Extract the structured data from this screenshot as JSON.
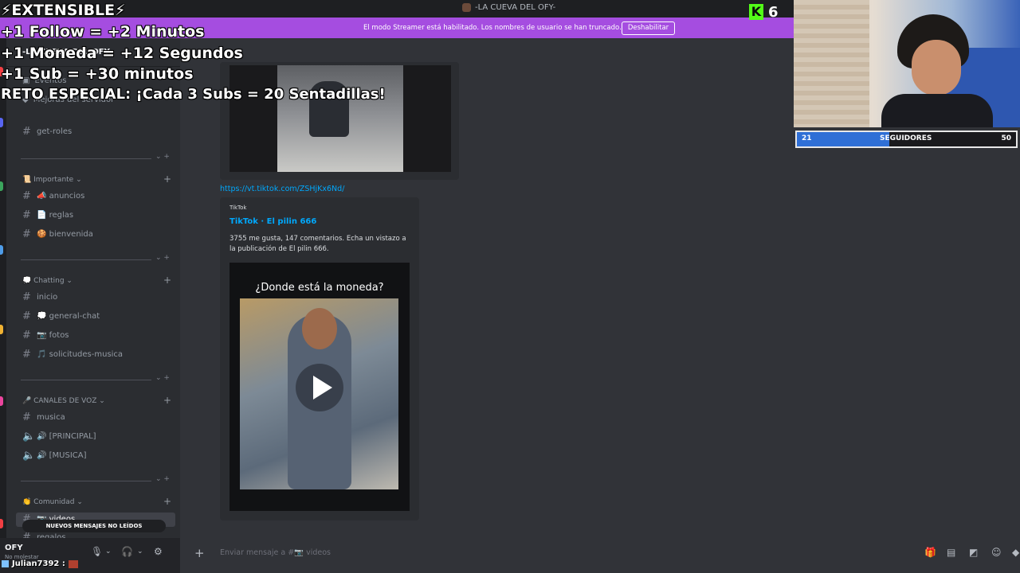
{
  "window": {
    "title": "-LA CUEVA DEL OFY-"
  },
  "banner": {
    "message": "El modo Streamer está habilitado. Los nombres de usuario se han truncado.",
    "button": "Deshabilitar"
  },
  "server": {
    "name": "-LA CUEVA DEL OFY-",
    "header_extra": "os"
  },
  "sidebar": {
    "top_items": [
      {
        "label": "Eventos"
      },
      {
        "label": "Mejoras del servidor"
      }
    ],
    "get_roles": "get-roles",
    "categories": [
      {
        "label": "📜 Importante",
        "chevron": "⌄",
        "channels": [
          "📣 anuncios",
          "📄 reglas",
          "🍪 bienvenida"
        ]
      },
      {
        "label": "💭 Chatting",
        "chevron": "⌄",
        "channels": [
          "inicio",
          "💭 general-chat",
          "📷 fotos",
          "🎵 solicitudes-musica"
        ]
      },
      {
        "label": "🎤 CANALES DE VOZ",
        "chevron": "⌄",
        "channels": [
          "musica",
          "🔊 [PRINCIPAL]",
          "🔊 [MUSICA]"
        ]
      },
      {
        "label": "👏 Comunidad",
        "chevron": "⌄",
        "channels": [
          "📷 videos",
          "regalos"
        ]
      }
    ],
    "divider_end": "⌄ +",
    "plus": "+",
    "unread_banner": "NUEVOS MENSAJES NO LEÍDOS"
  },
  "user": {
    "name": "OFY",
    "status": "No molestar"
  },
  "chat": {
    "link": "https://vt.tiktok.com/ZSHjKx6Nd/",
    "embed": {
      "provider": "TikTok",
      "title": "TikTok · El pilin 666",
      "description": "3755 me gusta, 147 comentarios. Echa un vistazo a la publicación de El pilin 666.",
      "video_caption": "¿Donde está la moneda?"
    },
    "input_placeholder": "Enviar mensaje a #📷 videos"
  },
  "overlay": {
    "lines": [
      "⚡EXTENSIBLE⚡",
      "+1 Follow = +2 Minutos",
      "+1 Moneda = +12 Segundos",
      "+1 Sub = +30 minutos",
      "RETO ESPECIAL: ¡Cada 3 Subs = 20 Sentadillas!"
    ],
    "kick_letter": "K",
    "kick_count": "6",
    "goal": {
      "label": "SEGUIDORES",
      "current": "21",
      "target": "50",
      "progress": 0.42
    },
    "chat_message": {
      "user": "Julian7392 :"
    }
  },
  "icons": {
    "mic": "mic-icon",
    "headset": "headset-icon",
    "settings": "gear-icon",
    "gift": "gift-icon",
    "gif": "gif-icon",
    "sticker": "sticker-icon",
    "emoji": "emoji-icon"
  },
  "colors": {
    "banner": "#a54de0",
    "link": "#00a8fc",
    "kick": "#53fc18",
    "goal_fill": "#2f6fd6"
  }
}
